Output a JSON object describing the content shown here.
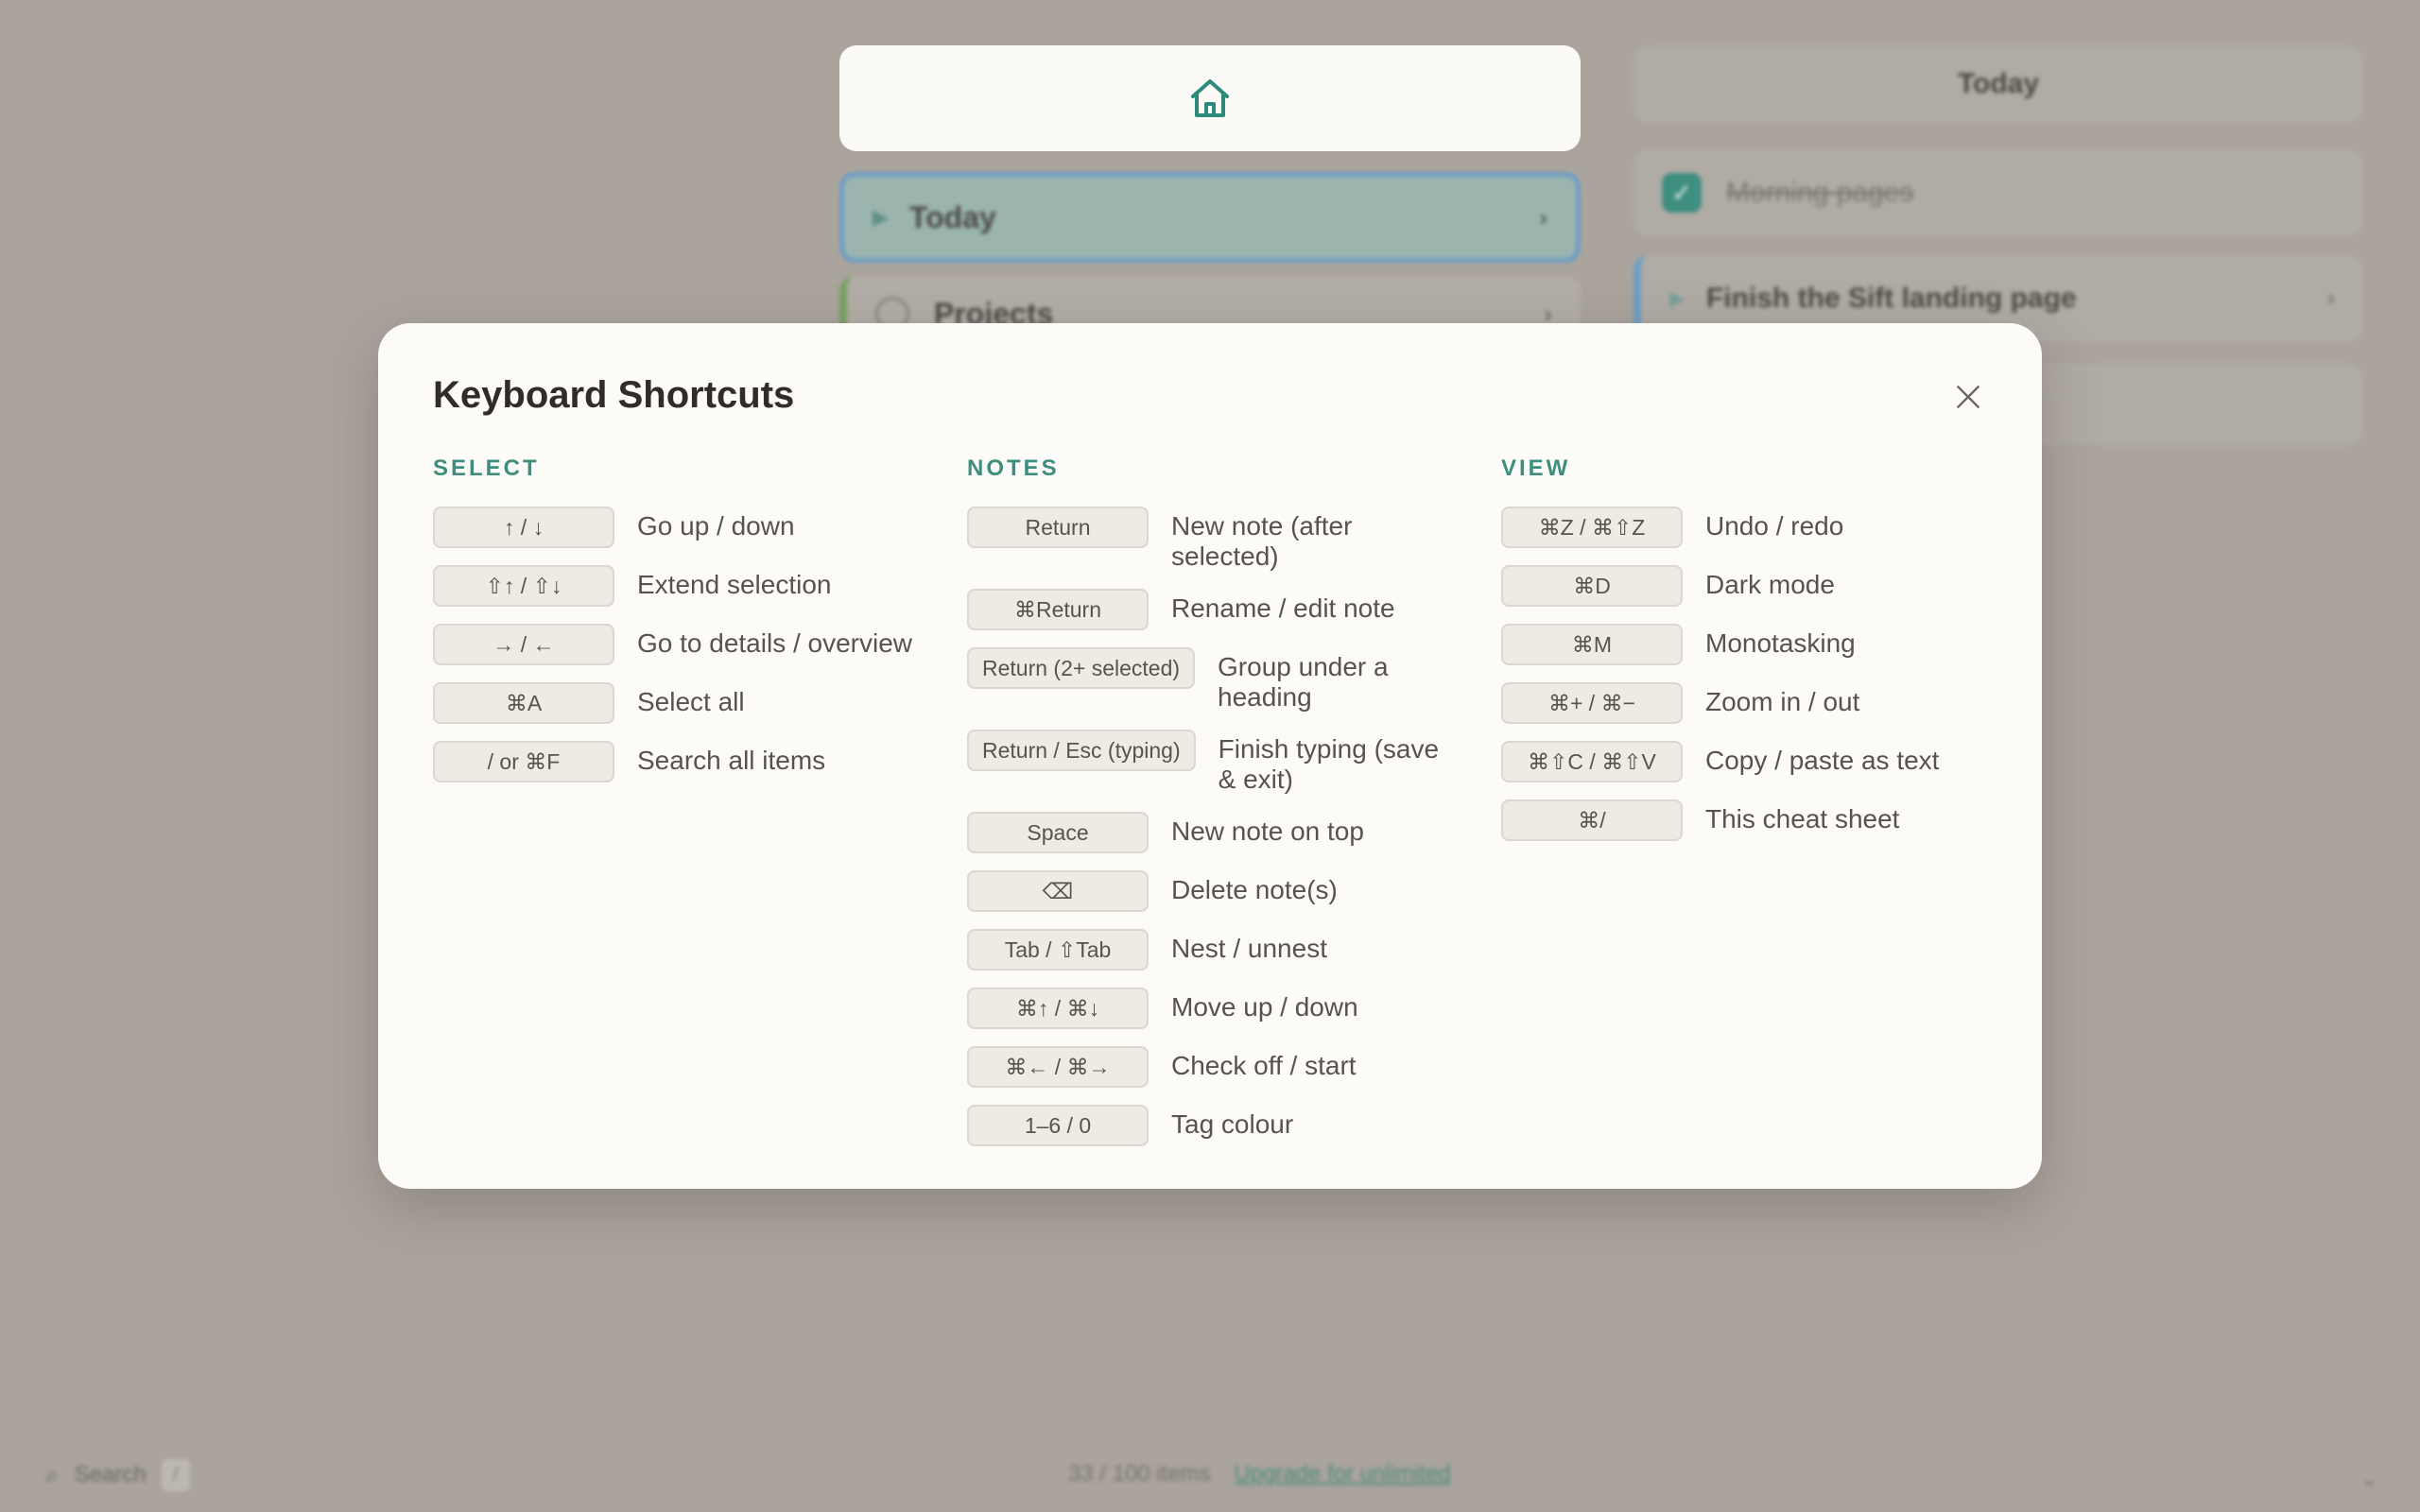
{
  "background": {
    "center": {
      "rows": [
        {
          "label": "Today"
        },
        {
          "label": "Projects"
        }
      ]
    },
    "right": {
      "header": "Today",
      "items": [
        {
          "label": "Morning pages",
          "done": true
        },
        {
          "label": "Finish the Sift landing page"
        }
      ]
    },
    "footer": {
      "search_label": "Search",
      "search_key": "/",
      "count": "33 / 100 items",
      "upgrade": "Upgrade for unlimited"
    }
  },
  "modal": {
    "title": "Keyboard Shortcuts",
    "close_icon": "close-icon",
    "columns": {
      "select": {
        "heading": "SELECT",
        "shortcuts": [
          {
            "key": "↑ / ↓",
            "desc": "Go up / down"
          },
          {
            "key": "⇧↑ / ⇧↓",
            "desc": "Extend selection"
          },
          {
            "key": "→ / ←",
            "desc": "Go to details / overview"
          },
          {
            "key": "⌘A",
            "desc": "Select all"
          },
          {
            "key": "/ or ⌘F",
            "desc": "Search all items"
          }
        ]
      },
      "notes": {
        "heading": "NOTES",
        "shortcuts": [
          {
            "key": "Return",
            "desc": "New note (after selected)"
          },
          {
            "key": "⌘Return",
            "desc": "Rename / edit note"
          },
          {
            "key": "Return (2+ selected)",
            "desc": "Group under a heading"
          },
          {
            "key": "Return / Esc (typing)",
            "desc": "Finish typing (save & exit)"
          },
          {
            "key": "Space",
            "desc": "New note on top"
          },
          {
            "key": "⌫",
            "desc": "Delete note(s)"
          },
          {
            "key": "Tab / ⇧Tab",
            "desc": "Nest / unnest"
          },
          {
            "key": "⌘↑ / ⌘↓",
            "desc": "Move up / down"
          },
          {
            "key": "⌘← / ⌘→",
            "desc": "Check off / start"
          },
          {
            "key": "1–6 / 0",
            "desc": "Tag colour"
          }
        ]
      },
      "view": {
        "heading": "VIEW",
        "shortcuts": [
          {
            "key": "⌘Z / ⌘⇧Z",
            "desc": "Undo / redo"
          },
          {
            "key": "⌘D",
            "desc": "Dark mode"
          },
          {
            "key": "⌘M",
            "desc": "Monotasking"
          },
          {
            "key": "⌘+ / ⌘−",
            "desc": "Zoom in / out"
          },
          {
            "key": "⌘⇧C / ⌘⇧V",
            "desc": "Copy / paste as text"
          },
          {
            "key": "⌘/",
            "desc": "This cheat sheet"
          }
        ]
      }
    }
  },
  "colors": {
    "accent": "#3e8e7f",
    "backdrop": "#aaa49d",
    "modal_bg": "#fcfbf7",
    "key_bg": "#eeebe4"
  }
}
